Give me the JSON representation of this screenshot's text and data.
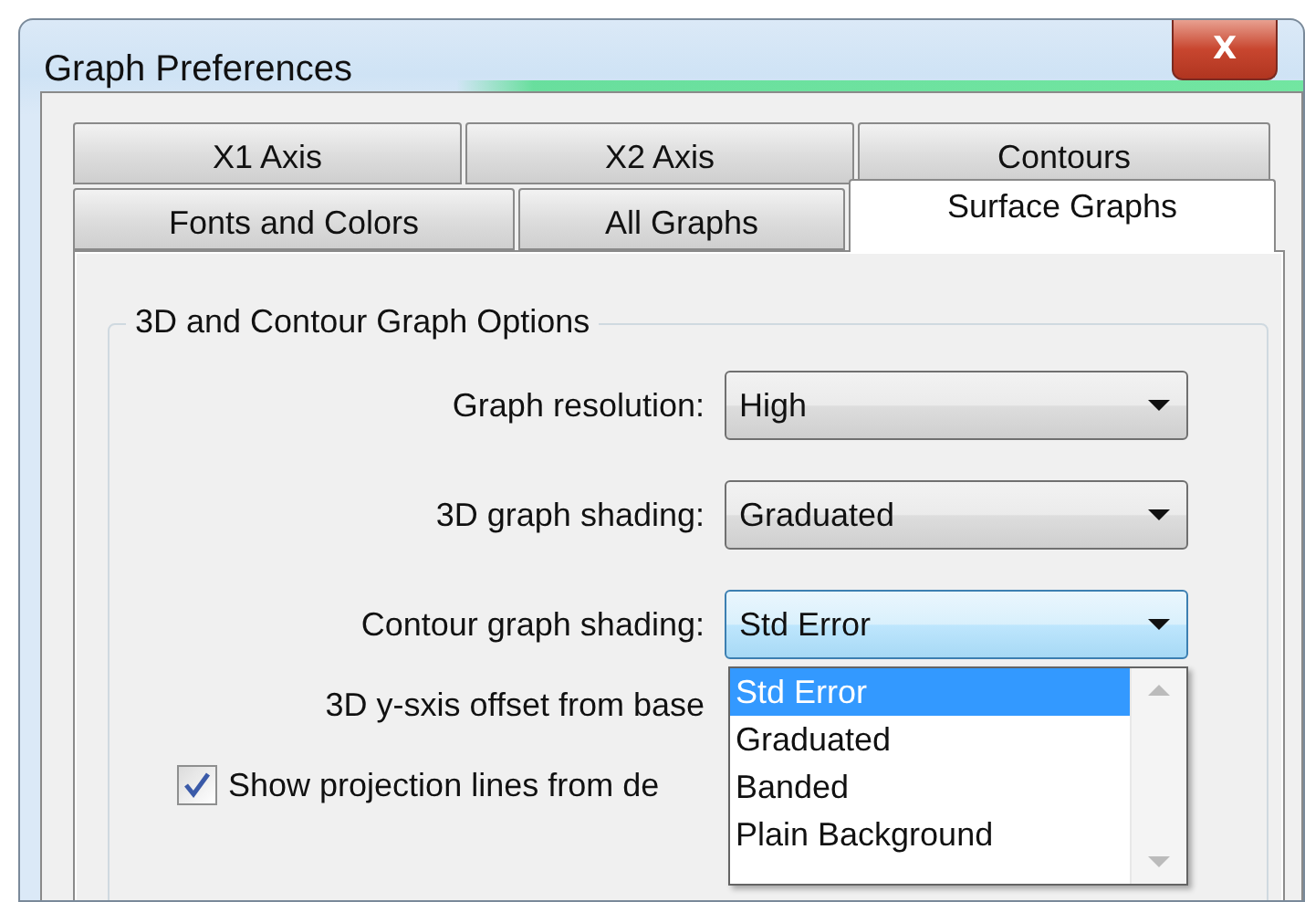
{
  "window": {
    "title": "Graph Preferences",
    "close": "X"
  },
  "tab_rows": [
    [
      {
        "label": "X1 Axis",
        "selected": false
      },
      {
        "label": "X2 Axis",
        "selected": false
      },
      {
        "label": "Contours",
        "selected": false
      }
    ],
    [
      {
        "label": "Fonts and Colors",
        "selected": false
      },
      {
        "label": "All Graphs",
        "selected": false
      },
      {
        "label": "Surface Graphs",
        "selected": true
      }
    ]
  ],
  "group": {
    "title": "3D and Contour Graph Options"
  },
  "combos": [
    {
      "label": "Graph resolution:",
      "value": "High",
      "expanded": false
    },
    {
      "label": "3D graph shading:",
      "value": "Graduated",
      "expanded": false
    },
    {
      "label": "Contour graph shading:",
      "value": "Std Error",
      "expanded": true,
      "options": [
        {
          "label": "Std Error",
          "selected": true
        },
        {
          "label": "Graduated",
          "selected": false
        },
        {
          "label": "Banded",
          "selected": false
        },
        {
          "label": "Plain Background",
          "selected": false
        }
      ]
    }
  ],
  "offset_label": "3D y-sxis offset from base",
  "checkbox": {
    "label": "Show projection lines from de",
    "checked": true
  }
}
